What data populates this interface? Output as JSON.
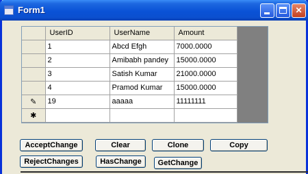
{
  "window": {
    "title": "Form1"
  },
  "grid": {
    "columns": [
      "UserID",
      "UserName",
      "Amount"
    ],
    "rows": [
      {
        "marker": "",
        "cells": [
          "1",
          "Abcd Efgh",
          "7000.0000"
        ]
      },
      {
        "marker": "",
        "cells": [
          "2",
          "Amibabh pandey",
          "15000.0000"
        ]
      },
      {
        "marker": "",
        "cells": [
          "3",
          "Satish Kumar",
          "21000.0000"
        ]
      },
      {
        "marker": "",
        "cells": [
          "4",
          "Pramod Kumar",
          "15000.0000"
        ]
      },
      {
        "marker": "✎",
        "cells": [
          "19",
          "aaaaa",
          "11111111"
        ]
      },
      {
        "marker": "✱",
        "cells": [
          "",
          "",
          ""
        ]
      }
    ]
  },
  "buttons": {
    "accept": "AcceptChange",
    "clear": "Clear",
    "clone": "Clone",
    "copy": "Copy",
    "reject": "RejectChanges",
    "haschange": "HasChange",
    "getchange": "GetChange"
  }
}
